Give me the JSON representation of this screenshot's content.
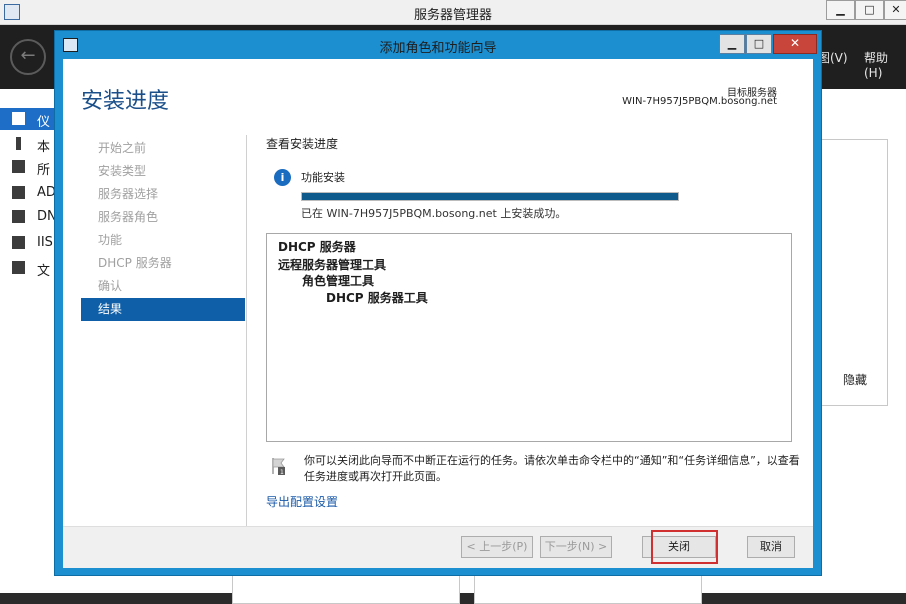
{
  "server_manager": {
    "title": "服务器管理器",
    "window_controls": [
      "▁",
      "□",
      "✕"
    ],
    "menu_view": "图(V)",
    "menu_help": "帮助(H)",
    "sidebar_items": [
      {
        "label": "仪",
        "icon": "dashboard-icon"
      },
      {
        "label": "本",
        "icon": "local-server-icon"
      },
      {
        "label": "所",
        "icon": "all-servers-icon"
      },
      {
        "label": "AD",
        "icon": "ad-icon"
      },
      {
        "label": "DN",
        "icon": "dns-icon"
      },
      {
        "label": "IIS",
        "icon": "iis-icon"
      },
      {
        "label": "文",
        "icon": "file-services-icon"
      }
    ],
    "hide_label": "隐藏"
  },
  "wizard": {
    "title": "添加角色和功能向导",
    "controls": {
      "minimize": "▁",
      "maximize": "□",
      "close": "✕"
    },
    "heading": "安装进度",
    "destination_label": "目标服务器",
    "destination_value": "WIN-7H957J5PBQM.bosong.net",
    "nav_items": [
      "开始之前",
      "安装类型",
      "服务器选择",
      "服务器角色",
      "功能",
      "DHCP 服务器",
      "确认",
      "结果"
    ],
    "active_nav_index": 7,
    "section_title": "查看安装进度",
    "feature_label": "功能安装",
    "progress_fraction": 1.0,
    "status_text": "已在 WIN-7H957J5PBQM.bosong.net 上安装成功。",
    "results": [
      {
        "text": "DHCP 服务器",
        "level": 0
      },
      {
        "text": "远程服务器管理工具",
        "level": 0
      },
      {
        "text": "角色管理工具",
        "level": 1
      },
      {
        "text": "DHCP 服务器工具",
        "level": 2
      }
    ],
    "notice": "你可以关闭此向导而不中断正在运行的任务。请依次单击命令栏中的“通知”和“任务详细信息”，以查看任务进度或再次打开此页面。",
    "export_link": "导出配置设置",
    "buttons": {
      "prev": "< 上一步(P)",
      "next": "下一步(N) >",
      "close": "关闭",
      "cancel": "取消"
    }
  }
}
